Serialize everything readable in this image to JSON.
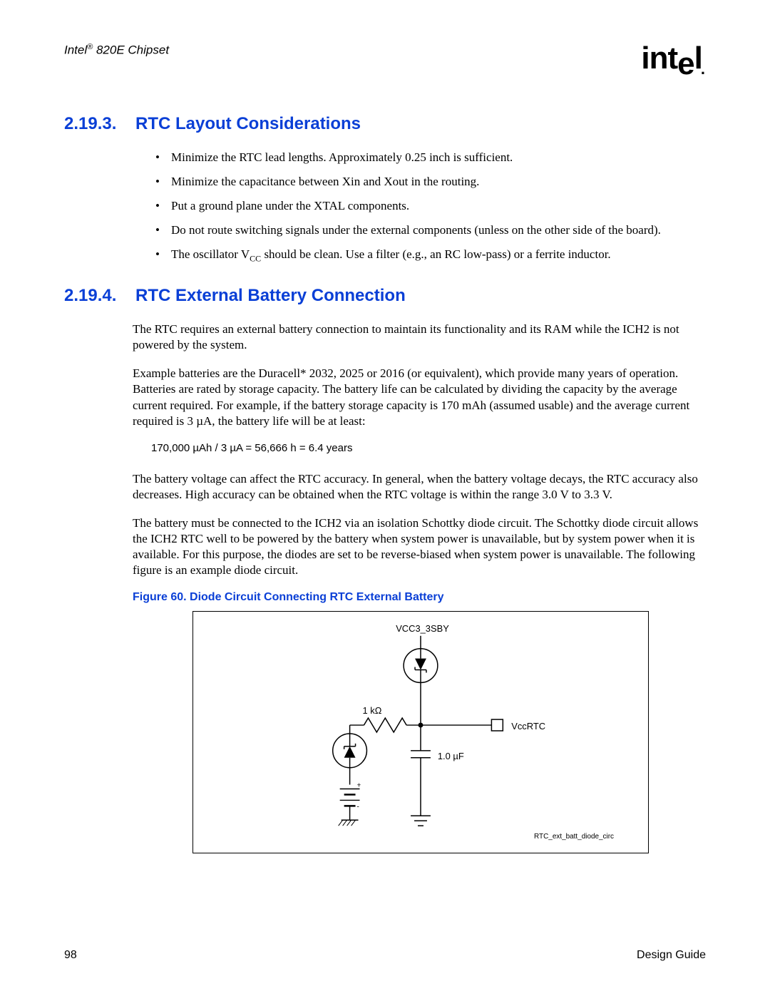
{
  "header": {
    "product_prefix": "Intel",
    "reg": "®",
    "product_suffix": " 820E Chipset",
    "logo_text": "intel"
  },
  "section1": {
    "number": "2.19.3.",
    "title": "RTC Layout Considerations",
    "bullets": [
      "Minimize the RTC lead lengths. Approximately 0.25 inch is sufficient.",
      "Minimize the capacitance between Xin and Xout in the routing.",
      "Put a ground plane under the XTAL components.",
      "Do not route switching signals under the external components (unless on the other side of the board).",
      "The oscillator V__CC__ should be clean. Use a filter (e.g., an RC low-pass) or a ferrite inductor."
    ]
  },
  "section2": {
    "number": "2.19.4.",
    "title": "RTC External Battery Connection",
    "para1": "The RTC requires an external battery connection to maintain its functionality and its RAM while the ICH2 is not powered by the system.",
    "para2": "Example batteries are the Duracell* 2032, 2025 or 2016 (or equivalent), which provide many years of operation. Batteries are rated by storage capacity. The battery life can be calculated by dividing the capacity by the average current required. For example, if the battery storage capacity is 170 mAh (assumed usable) and the average current required is 3 µA, the battery life will be at least:",
    "calc": "170,000 µAh / 3 µA = 56,666 h = 6.4 years",
    "para3": "The battery voltage can affect the RTC accuracy. In general, when the battery voltage decays, the RTC accuracy also decreases. High accuracy can be obtained when the RTC voltage is within the range 3.0 V to 3.3 V.",
    "para4": "The battery must be connected to the ICH2 via an isolation Schottky diode circuit. The Schottky diode circuit allows the ICH2 RTC well to be powered by the battery when system power is unavailable, but by system power when it is available. For this purpose, the diodes are set to be reverse-biased when system power is unavailable. The following figure is an example diode circuit."
  },
  "figure": {
    "caption": "Figure 60. Diode Circuit Connecting RTC External Battery",
    "labels": {
      "vcc3": "VCC3_3SBY",
      "r": "1 kΩ",
      "c": "1.0 µF",
      "out": "VccRTC",
      "id": "RTC_ext_batt_diode_circ"
    }
  },
  "footer": {
    "page": "98",
    "doc": "Design Guide"
  }
}
